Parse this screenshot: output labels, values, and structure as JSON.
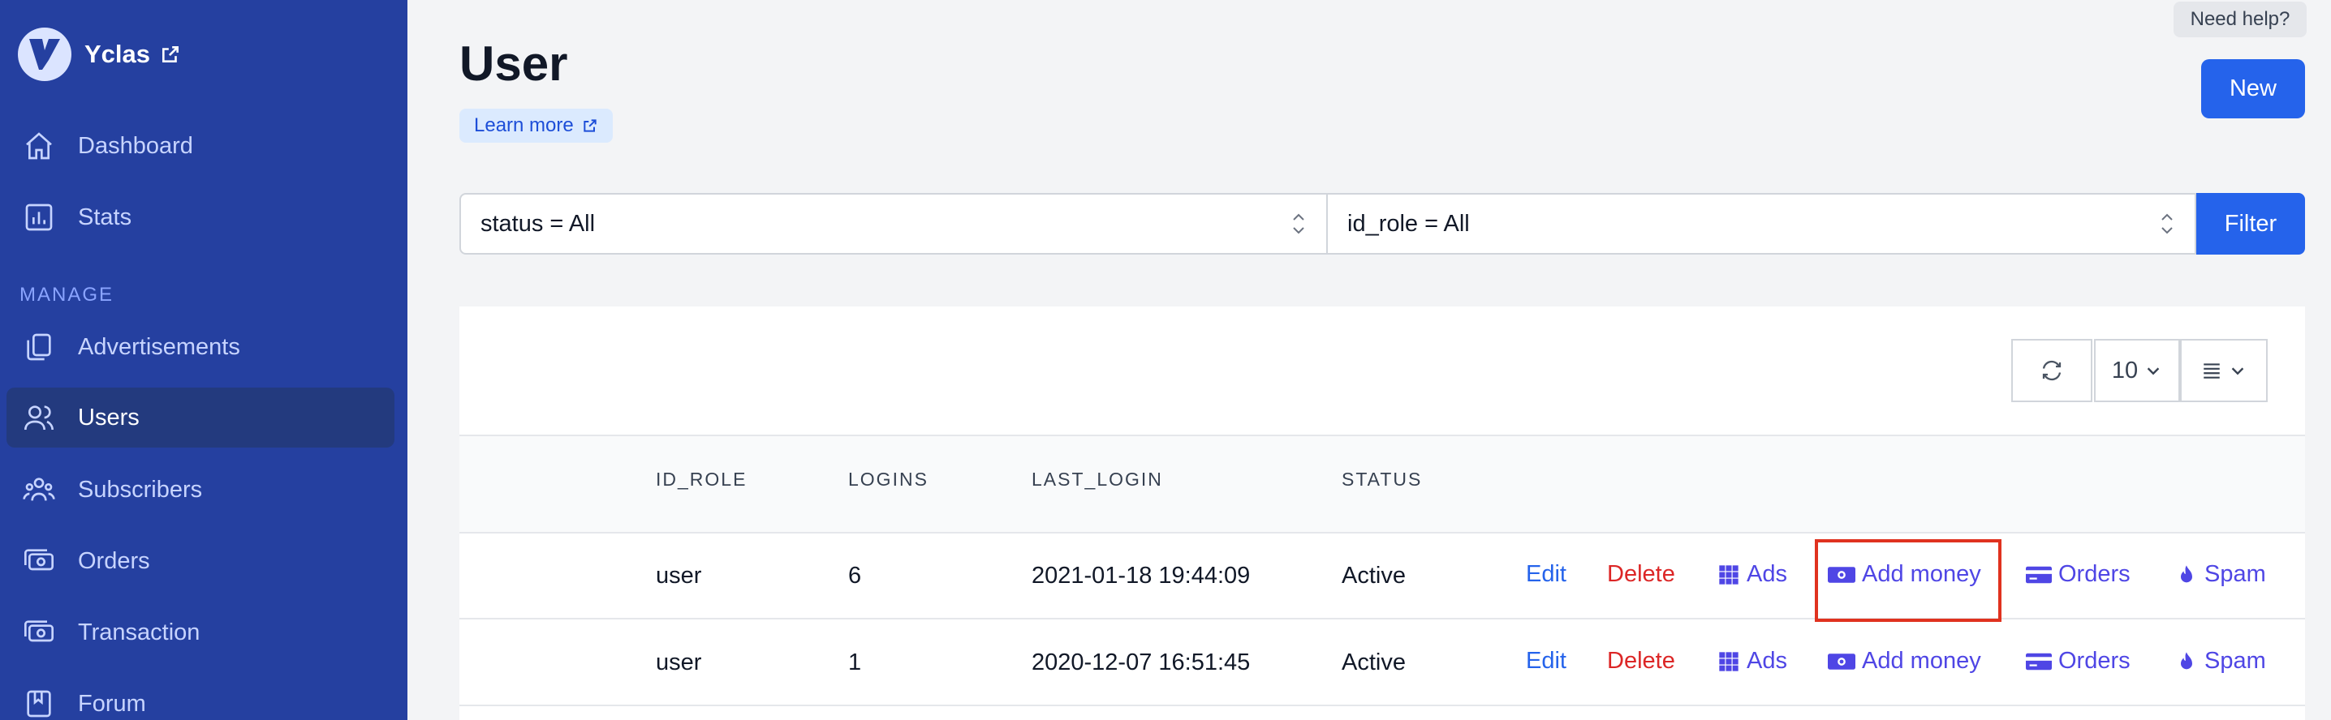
{
  "sidebar": {
    "brand": "Yclas",
    "section_manage": "MANAGE",
    "items": [
      {
        "label": "Dashboard",
        "icon": "home-icon"
      },
      {
        "label": "Stats",
        "icon": "chart-icon"
      },
      {
        "label": "Advertisements",
        "icon": "documents-icon"
      },
      {
        "label": "Users",
        "icon": "users-icon",
        "active": true
      },
      {
        "label": "Subscribers",
        "icon": "user-group-icon"
      },
      {
        "label": "Orders",
        "icon": "cash-icon"
      },
      {
        "label": "Transaction",
        "icon": "cash-icon"
      },
      {
        "label": "Forum",
        "icon": "book-icon"
      }
    ]
  },
  "header": {
    "title": "User",
    "learn_more": "Learn more",
    "need_help": "Need help?",
    "new_button": "New"
  },
  "filters": {
    "status": "status = All",
    "id_role": "id_role = All",
    "button": "Filter"
  },
  "table": {
    "page_size": "10",
    "columns": [
      "ID_ROLE",
      "LOGINS",
      "LAST_LOGIN",
      "STATUS"
    ],
    "actions": {
      "edit": "Edit",
      "delete": "Delete",
      "ads": "Ads",
      "add_money": "Add money",
      "orders": "Orders",
      "spam": "Spam"
    },
    "rows": [
      {
        "id_role": "user",
        "logins": "6",
        "last_login": "2021-01-18 19:44:09",
        "status": "Active"
      },
      {
        "id_role": "user",
        "logins": "1",
        "last_login": "2020-12-07 16:51:45",
        "status": "Active"
      }
    ]
  },
  "colors": {
    "sidebar_bg": "#2540a0",
    "primary": "#2563eb",
    "danger": "#dc2626",
    "action_purple": "#4f46e5",
    "highlight": "#e0321f"
  }
}
